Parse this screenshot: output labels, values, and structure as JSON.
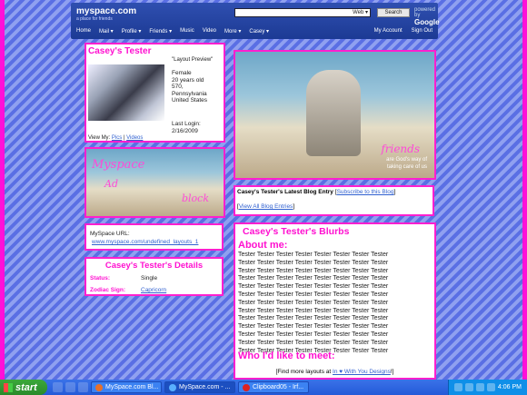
{
  "header": {
    "logo": "myspace.com",
    "tagline": "a place for friends",
    "search_scope": "Web",
    "search_button": "Search",
    "powered_by": "powered by",
    "google": "Google",
    "nav": [
      "Home",
      "Mail ▾",
      "Profile ▾",
      "Friends ▾",
      "Music",
      "Video",
      "More ▾",
      "Casey ▾"
    ],
    "nav_right": [
      "My Account",
      "Sign Out"
    ]
  },
  "profile": {
    "name": "Casey's Tester",
    "headline": "\"Layout Preview\"",
    "info": [
      "Female",
      "20 years old",
      "570,",
      "Pennsylvania",
      "United States"
    ],
    "last_login_label": "Last Login:",
    "last_login": "2/16/2009",
    "view_my": "View My:",
    "pics": "Pics",
    "videos": "Videos",
    "sep": "|"
  },
  "banner_small": {
    "text1": "Myspace",
    "text2": "Ad",
    "text3": "block"
  },
  "url_box": {
    "label": "MySpace URL:",
    "url": "www.myspace.com/undefined_layouts_1"
  },
  "details": {
    "title": "Casey's Tester's Details",
    "rows": [
      {
        "label": "Status:",
        "value": "Single"
      },
      {
        "label": "Zodiac Sign:",
        "value": "Capricorn"
      }
    ]
  },
  "main_image": {
    "caption1": "friends",
    "caption2": "are God's way of",
    "caption3": "taking care of us"
  },
  "blog": {
    "title": "Casey's Tester's Latest Blog Entry",
    "subscribe": "Subscribe to this Blog",
    "view_all": "View All Blog Entries"
  },
  "blurbs": {
    "title": "Casey's Tester's Blurbs",
    "about_heading": "About me:",
    "about_lines": [
      "Tester Tester Tester Tester Tester Tester Tester Tester",
      "Tester Tester Tester Tester Tester Tester Tester Tester",
      "Tester Tester Tester Tester Tester Tester Tester Tester",
      "Tester Tester Tester Tester Tester Tester Tester Tester",
      "Tester Tester Tester Tester Tester Tester Tester Tester",
      "Tester Tester Tester Tester Tester Tester Tester Tester",
      "Tester Tester Tester Tester Tester Tester Tester Tester",
      "Tester Tester Tester Tester Tester Tester Tester Tester",
      "Tester Tester Tester Tester Tester Tester Tester Tester",
      "Tester Tester Tester Tester Tester Tester Tester Tester",
      "Tester Tester Tester Tester Tester Tester Tester Tester",
      "Tester Tester Tester Tester Tester Tester Tester Tester",
      "Tester Tester Tester Tester Tester Tester Tester Tester"
    ],
    "meet_heading": "Who I'd like to meet:",
    "more_prefix": "[Find more layouts at ",
    "more_link": "In ♥ With You Designs",
    "more_suffix": "!]"
  },
  "taskbar": {
    "start": "start",
    "tasks": [
      "MySpace.com Bl...",
      "MySpace.com - ...",
      "Clipboard05 - Irf..."
    ],
    "clock": "4:06 PM"
  },
  "colors": {
    "accent": "#ff10d0",
    "link": "#3060d0"
  }
}
